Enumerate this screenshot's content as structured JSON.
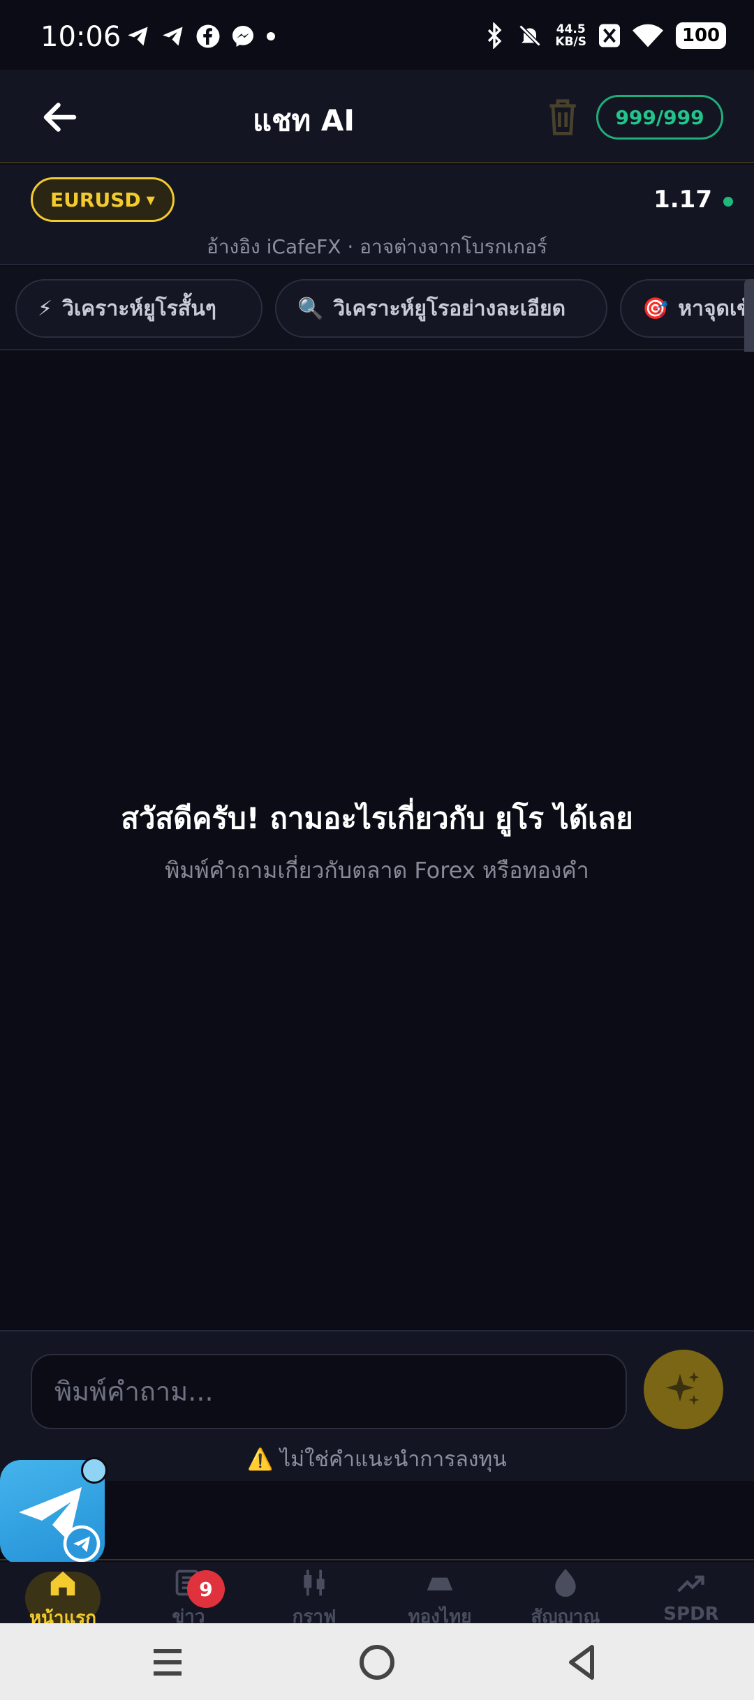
{
  "status_bar": {
    "time": "10:06",
    "net_speed_value": "44.5",
    "net_speed_unit": "KB/S",
    "battery": "100",
    "icons": [
      "telegram-icon",
      "telegram-icon",
      "facebook-icon",
      "messenger-icon",
      "dot-icon",
      "bluetooth-icon",
      "bell-muted-icon",
      "x-icon",
      "wifi-icon",
      "battery-icon"
    ]
  },
  "header": {
    "title": "แชท AI",
    "quota": "999/999"
  },
  "symbol_bar": {
    "symbol": "EURUSD",
    "price": "1.17",
    "source_note": "อ้างอิง iCafeFX · อาจต่างจากโบรกเกอร์"
  },
  "chips": [
    {
      "icon": "⚡",
      "label": "วิเคราะห์ยูโรสั้นๆ"
    },
    {
      "icon": "🔍",
      "label": "วิเคราะห์ยูโรอย่างละเอียด"
    },
    {
      "icon": "🎯",
      "label": "หาจุดเข้"
    }
  ],
  "chat": {
    "welcome_title": "สวัสดีครับ! ถามอะไรเกี่ยวกับ ยูโร ได้เลย",
    "welcome_sub": "พิมพ์คำถามเกี่ยวกับตลาด Forex หรือทองคำ"
  },
  "input": {
    "placeholder": "พิมพ์คำถาม...",
    "disclaimer": "⚠️ ไม่ใช่คำแนะนำการลงทุน"
  },
  "bottom_nav": {
    "items": [
      {
        "label": "หน้าแรก",
        "icon": "home-icon",
        "active": true
      },
      {
        "label": "ข่าว",
        "icon": "news-icon",
        "badge": "9"
      },
      {
        "label": "กราฟ",
        "icon": "candlestick-icon"
      },
      {
        "label": "ทองไทย",
        "icon": "gold-bar-icon"
      },
      {
        "label": "สัญญาณ",
        "icon": "flame-icon"
      },
      {
        "label": "SPDR",
        "icon": "trend-up-icon"
      }
    ]
  },
  "colors": {
    "accent_gold": "#f4cb2e",
    "accent_green": "#22c48a",
    "background": "#0b0c15",
    "panel": "#131523",
    "badge_red": "#e0323c"
  }
}
